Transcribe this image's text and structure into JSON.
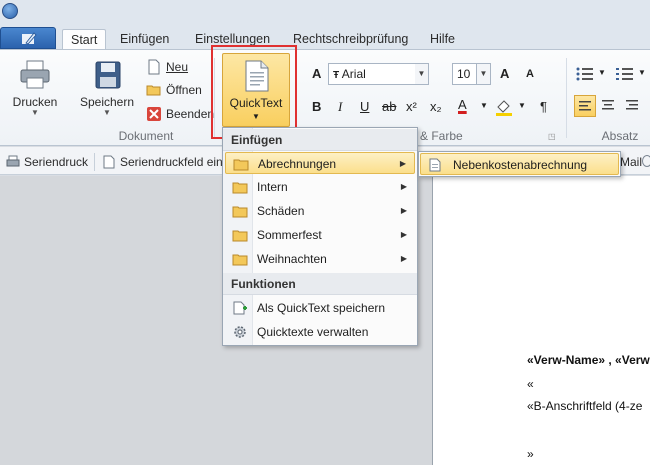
{
  "tabs": [
    "Start",
    "Einfügen",
    "Einstellungen",
    "Rechtschreibprüfung",
    "Hilfe"
  ],
  "ribbon": {
    "drucken": "Drucken",
    "speichern": "Speichern",
    "neu": "Neu",
    "oeffnen": "Öffnen",
    "beenden": "Beenden",
    "group_dokument": "Dokument",
    "quicktext": "QuickText",
    "font_name": "Arial",
    "font_size": "10",
    "group_schrift": "t & Farbe",
    "group_absatz": "Absatz",
    "fmt_bold": "B",
    "fmt_italic": "I",
    "fmt_underline": "U",
    "fmt_strike": "ab",
    "fmt_super": "x²",
    "fmt_sub": "x₂",
    "fmt_color": "A",
    "fmt_pilcrow": "¶",
    "grow": "A",
    "shrink": "A"
  },
  "toolbar2": {
    "seriendruck": "Seriendruck",
    "seriendruckfeld": "Seriendruckfeld einf",
    "mail": "Mail"
  },
  "menu": {
    "header_einfuegen": "Einfügen",
    "items": [
      "Abrechnungen",
      "Intern",
      "Schäden",
      "Sommerfest",
      "Weihnachten"
    ],
    "header_funktionen": "Funktionen",
    "func_save": "Als QuickText speichern",
    "func_manage": "Quicktexte verwalten"
  },
  "submenu": {
    "item": "Nebenkostenabrechnung"
  },
  "document": {
    "line1": "«Verw-Name» , «Verw",
    "line2": "«",
    "line3": "«B-Anschriftfeld (4-ze",
    "line4": "»"
  }
}
